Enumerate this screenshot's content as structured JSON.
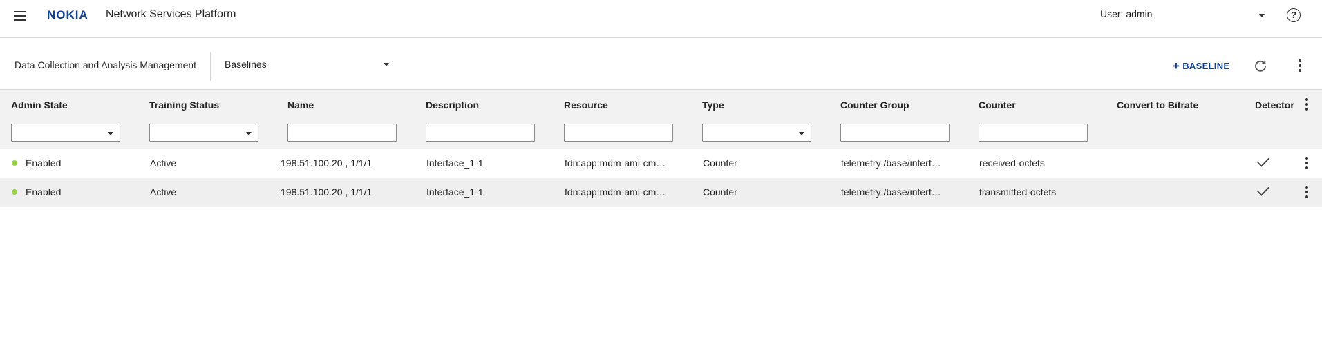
{
  "header": {
    "brand": "NOKIA",
    "app_title": "Network Services Platform",
    "user": "User: admin",
    "help": "?"
  },
  "toolbar": {
    "breadcrumb": "Data Collection and Analysis Management",
    "view_selected": "Baselines",
    "add_label": "BASELINE"
  },
  "table": {
    "columns": [
      "Admin State",
      "Training Status",
      "Name",
      "Description",
      "Resource",
      "Type",
      "Counter Group",
      "Counter",
      "Convert to Bitrate",
      "Detector"
    ],
    "rows": [
      {
        "admin_state": "Enabled",
        "training_status": "Active",
        "name": "198.51.100.20 , 1/1/1",
        "description": "Interface_1-1",
        "resource": "fdn:app:mdm-ami-cm…",
        "type": "Counter",
        "counter_group": "telemetry:/base/interf…",
        "counter": "received-octets",
        "convert_to_bitrate": "",
        "detector": "check"
      },
      {
        "admin_state": "Enabled",
        "training_status": "Active",
        "name": "198.51.100.20 , 1/1/1",
        "description": "Interface_1-1",
        "resource": "fdn:app:mdm-ami-cm…",
        "type": "Counter",
        "counter_group": "telemetry:/base/interf…",
        "counter": "transmitted-octets",
        "convert_to_bitrate": "",
        "detector": "check"
      }
    ]
  },
  "colors": {
    "brand": "#124191",
    "status_enabled": "#9ad24b",
    "header_bg": "#f2f2f2"
  },
  "icons": [
    "menu-icon",
    "help-icon",
    "chevron-down-icon",
    "plus-icon",
    "refresh-icon",
    "more-vertical-icon",
    "status-dot-icon",
    "checkmark-icon"
  ]
}
